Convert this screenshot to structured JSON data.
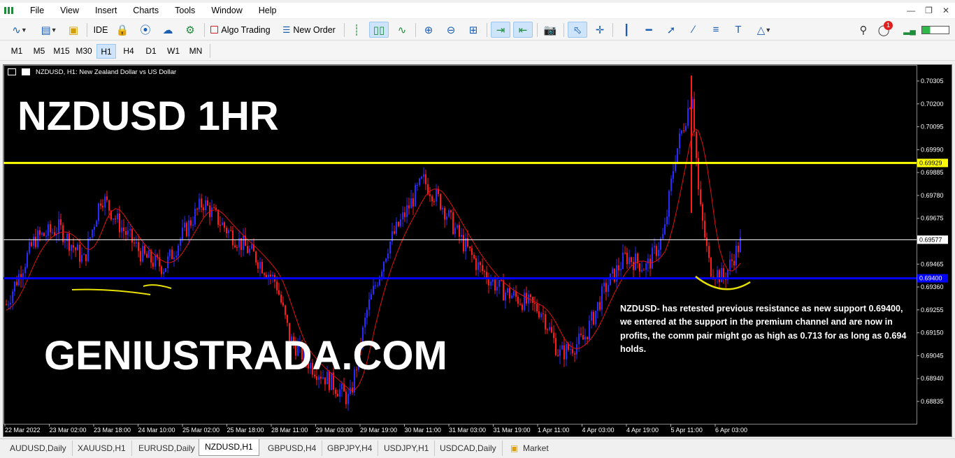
{
  "menu": [
    "File",
    "View",
    "Insert",
    "Charts",
    "Tools",
    "Window",
    "Help"
  ],
  "toolbar": {
    "ide_label": "IDE",
    "algo_trading_label": "Algo Trading",
    "new_order_label": "New Order",
    "notification_count": "1"
  },
  "timeframes": [
    "M1",
    "M5",
    "M15",
    "M30",
    "H1",
    "H4",
    "D1",
    "W1",
    "MN"
  ],
  "active_timeframe": "H1",
  "chart": {
    "symbol_title": "NZDUSD, H1:  New Zealand Dollar vs US Dollar",
    "overlay_title": "NZDUSD 1HR",
    "overlay_site": "GENIUSTRADA.COM",
    "note": "NZDUSD- has retested previous resistance as new support 0.69400, we entered at the support in the premium channel and are now in profits, the comm pair might go as high as 0.713 for as long as 0.694 holds.",
    "price_labels": [
      "0.70305",
      "0.70200",
      "0.70095",
      "0.69990",
      "0.69885",
      "0.69780",
      "0.69675",
      "0.69465",
      "0.69360",
      "0.69255",
      "0.69150",
      "0.69045",
      "0.68940",
      "0.68835"
    ],
    "time_labels": [
      "22 Mar 2022",
      "23 Mar 02:00",
      "23 Mar 18:00",
      "24 Mar 10:00",
      "25 Mar 02:00",
      "25 Mar 18:00",
      "28 Mar 11:00",
      "29 Mar 03:00",
      "29 Mar 19:00",
      "30 Mar 11:00",
      "31 Mar 03:00",
      "31 Mar 19:00",
      "1 Apr 11:00",
      "4 Apr 03:00",
      "4 Apr 19:00",
      "5 Apr 11:00",
      "6 Apr 03:00"
    ],
    "levels": {
      "resistance": "0.69929",
      "current": "0.69577",
      "support": "0.69400"
    },
    "colors": {
      "background": "#000000",
      "bull_candle": "#2a2aff",
      "bear_candle": "#ff1a1a",
      "moving_average": "#e01010",
      "resistance_line": "#ffff00",
      "support_line": "#0000ff",
      "annotation": "#e8e000"
    }
  },
  "symbol_tabs": [
    "AUDUSD,Daily",
    "XAUUSD,H1",
    "EURUSD,Daily",
    "NZDUSD,H1",
    "GBPUSD,H4",
    "GBPJPY,H4",
    "USDJPY,H1",
    "USDCAD,Daily",
    "Market"
  ],
  "active_tab": "NZDUSD,H1"
}
